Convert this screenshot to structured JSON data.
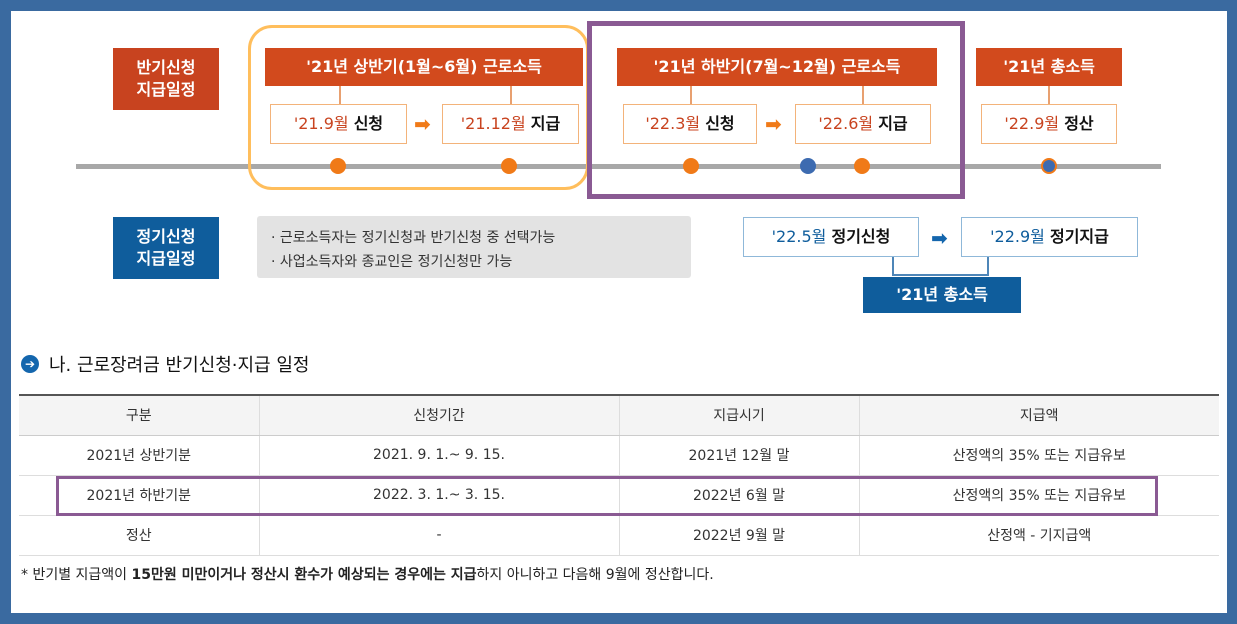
{
  "labels": {
    "semiannual": [
      "반기신청",
      "지급일정"
    ],
    "regular": [
      "정기신청",
      "지급일정"
    ]
  },
  "first_half": {
    "head": "'21년 상반기(1월~6월) 근로소득",
    "apply_num": "'21.9월",
    "apply_word": "신청",
    "pay_num": "'21.12월",
    "pay_word": "지급"
  },
  "second_half": {
    "head": "'21년 하반기(7월~12월) 근로소득",
    "apply_num": "'22.3월",
    "apply_word": "신청",
    "pay_num": "'22.6월",
    "pay_word": "지급"
  },
  "total": {
    "head": "'21년 총소득",
    "settle_num": "'22.9월",
    "settle_word": "정산"
  },
  "notes": [
    "· 근로소득자는 정기신청과 반기신청 중 선택가능",
    "· 사업소득자와 종교인은 정기신청만 가능"
  ],
  "regular": {
    "apply_num": "'22.5월",
    "apply_word": "정기신청",
    "pay_num": "'22.9월",
    "pay_word": "정기지급",
    "total": "'21년 총소득"
  },
  "section": {
    "icon": "➔",
    "title": "나. 근로장려금 반기신청·지급 일정"
  },
  "table": {
    "headers": [
      "구분",
      "신청기간",
      "지급시기",
      "지급액"
    ],
    "rows": [
      [
        "2021년 상반기분",
        "2021. 9. 1.~ 9. 15.",
        "2021년 12월 말",
        "산정액의 35% 또는 지급유보"
      ],
      [
        "2021년 하반기분",
        "2022. 3. 1.~ 3. 15.",
        "2022년 6월 말",
        "산정액의 35% 또는 지급유보"
      ],
      [
        "정산",
        "-",
        "2022년 9월 말",
        "산정액 - 기지급액"
      ]
    ]
  },
  "footnote": {
    "pre": "* 반기별 지급액이 ",
    "bold": "15만원 미만이거나 정산시 환수가 예상되는 경우에는 지급",
    "post": "하지 아니하고 다음해 9월에 정산합니다."
  },
  "colors": {
    "red": "#c8431f",
    "blue": "#0f5d9c",
    "orange": "#f07a18",
    "purple": "#8a5a93",
    "frame": "#3a6aa0"
  }
}
